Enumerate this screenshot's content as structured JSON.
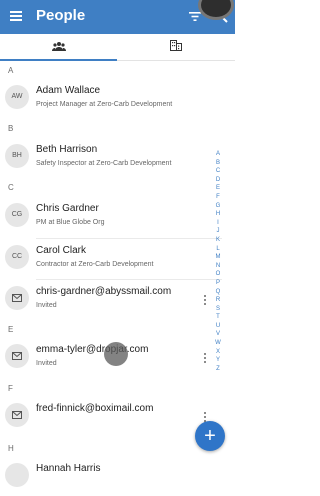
{
  "app": {
    "title": "People"
  },
  "sections": [
    "A",
    "B",
    "C",
    "E",
    "F",
    "H"
  ],
  "contacts": [
    {
      "initials": "AW",
      "name": "Adam Wallace",
      "subtitle": "Project Manager at Zero-Carb Development"
    },
    {
      "initials": "BH",
      "name": "Beth Harrison",
      "subtitle": "Safety Inspector at Zero-Carb Development"
    },
    {
      "initials": "CG",
      "name": "Chris Gardner",
      "subtitle": "PM at Blue Globe Org"
    },
    {
      "initials": "CC",
      "name": "Carol Clark",
      "subtitle": "Contractor at Zero-Carb Development"
    },
    {
      "email": "chris-gardner@abyssmail.com",
      "status": "Invited"
    },
    {
      "email": "emma-tyler@dropjar.com",
      "status": "Invited"
    },
    {
      "email": "fred-finnick@boximail.com",
      "status": ""
    },
    {
      "name": "Hannah Harris"
    }
  ],
  "alphabet": [
    "A",
    "B",
    "C",
    "D",
    "E",
    "F",
    "G",
    "H",
    "I",
    "J",
    "K",
    "L",
    "M",
    "N",
    "O",
    "P",
    "Q",
    "R",
    "S",
    "T",
    "U",
    "V",
    "W",
    "X",
    "Y",
    "Z"
  ],
  "colors": {
    "primary": "#3f7fc4",
    "fab": "#2f75c8"
  }
}
